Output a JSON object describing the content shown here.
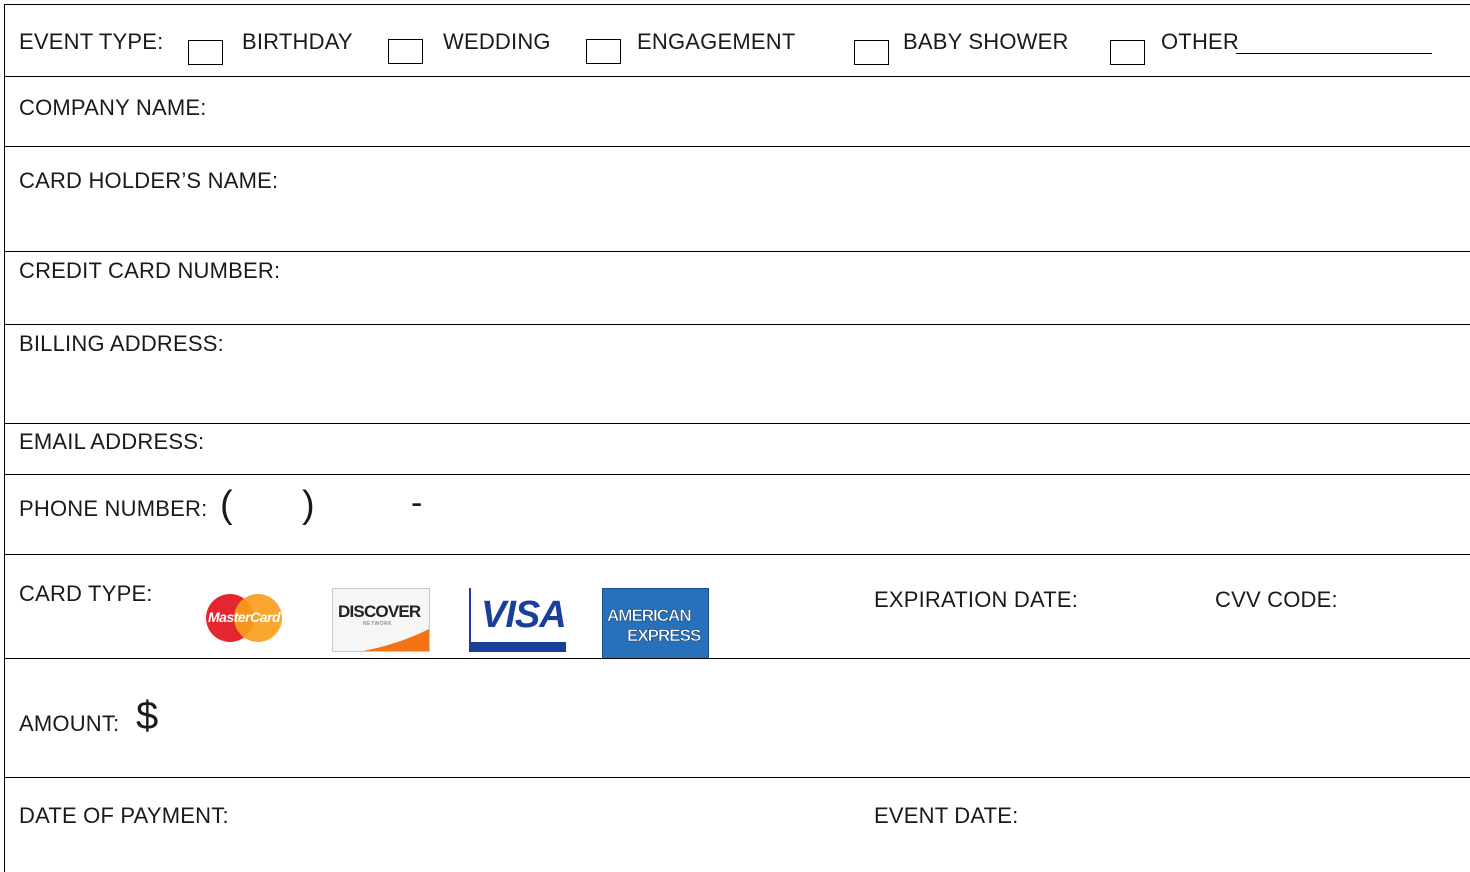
{
  "event_type": {
    "label": "EVENT TYPE:",
    "options": [
      {
        "label": "BIRTHDAY",
        "checked": false
      },
      {
        "label": "WEDDING",
        "checked": false
      },
      {
        "label": "ENGAGEMENT",
        "checked": false
      },
      {
        "label": "BABY SHOWER",
        "checked": false
      },
      {
        "label": "OTHER",
        "checked": false
      }
    ]
  },
  "fields": {
    "company_name": "COMPANY NAME:",
    "card_holder_name": "CARD HOLDER’S NAME:",
    "credit_card_number": "CREDIT CARD NUMBER:",
    "billing_address": "BILLING ADDRESS:",
    "email_address": "EMAIL ADDRESS:",
    "phone_number": "PHONE NUMBER:",
    "phone_open_paren": "(",
    "phone_close_paren": ")",
    "phone_dash": "-",
    "card_type": "CARD TYPE:",
    "expiration_date": "EXPIRATION DATE:",
    "cvv_code": "CVV CODE:",
    "amount": "AMOUNT:",
    "amount_symbol": "$",
    "date_of_payment": "DATE OF PAYMENT:",
    "event_date": "EVENT DATE:"
  },
  "card_logos": {
    "mastercard": {
      "text": "MasterCard",
      "colors": {
        "red": "#e3262f",
        "orange": "#f79e1b"
      }
    },
    "discover": {
      "text": "DISCOVER",
      "subtext": "NETWORK",
      "colors": {
        "orange": "#f47216"
      }
    },
    "visa": {
      "text": "VISA",
      "colors": {
        "blue": "#1a3f9a",
        "gold": "#f7b600"
      }
    },
    "amex": {
      "line1": "AMERICAN",
      "line2": "EXPRESS",
      "colors": {
        "blue": "#2671b9"
      }
    }
  }
}
